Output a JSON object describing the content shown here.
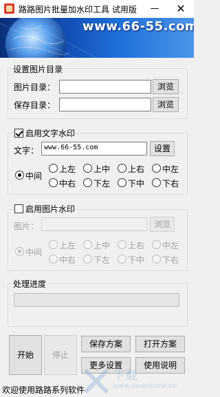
{
  "window": {
    "title": "路路图片批量加水印工具 试用版",
    "minimize_glyph": "—",
    "close_glyph": "✕"
  },
  "banner": {
    "url_text": "www.66-55.com"
  },
  "dirs": {
    "group_label": "设置图片目录",
    "image_dir_label": "图片目录：",
    "image_dir_value": "",
    "save_dir_label": "保存目录：",
    "save_dir_value": "",
    "browse_label": "浏览"
  },
  "text_watermark": {
    "enabled": true,
    "checkbox_label": "启用文字水印",
    "text_label": "文字：",
    "text_value": "www.66-55.com",
    "settings_label": "设置",
    "selected_position": "中间",
    "positions": [
      "中间",
      "上左",
      "上中",
      "上右",
      "中左",
      "中右",
      "下左",
      "下中",
      "下右"
    ]
  },
  "image_watermark": {
    "enabled": false,
    "checkbox_label": "启用图片水印",
    "image_label": "图片：",
    "image_value": "",
    "browse_label": "浏览",
    "selected_position": "中间",
    "positions": [
      "中间",
      "上左",
      "上中",
      "上右",
      "中左",
      "中右",
      "下左",
      "下中",
      "下右"
    ]
  },
  "progress": {
    "group_label": "处理进度",
    "value": 0
  },
  "actions": {
    "start": "开始",
    "stop": "停止",
    "save_scheme": "保存方案",
    "open_scheme": "打开方案",
    "more_settings": "更多设置",
    "help": "使用说明"
  },
  "status": {
    "text": "欢迎使用路路系列软件"
  },
  "overlay": {
    "site_text": "下载",
    "site_url": "www.downbank.cn"
  }
}
